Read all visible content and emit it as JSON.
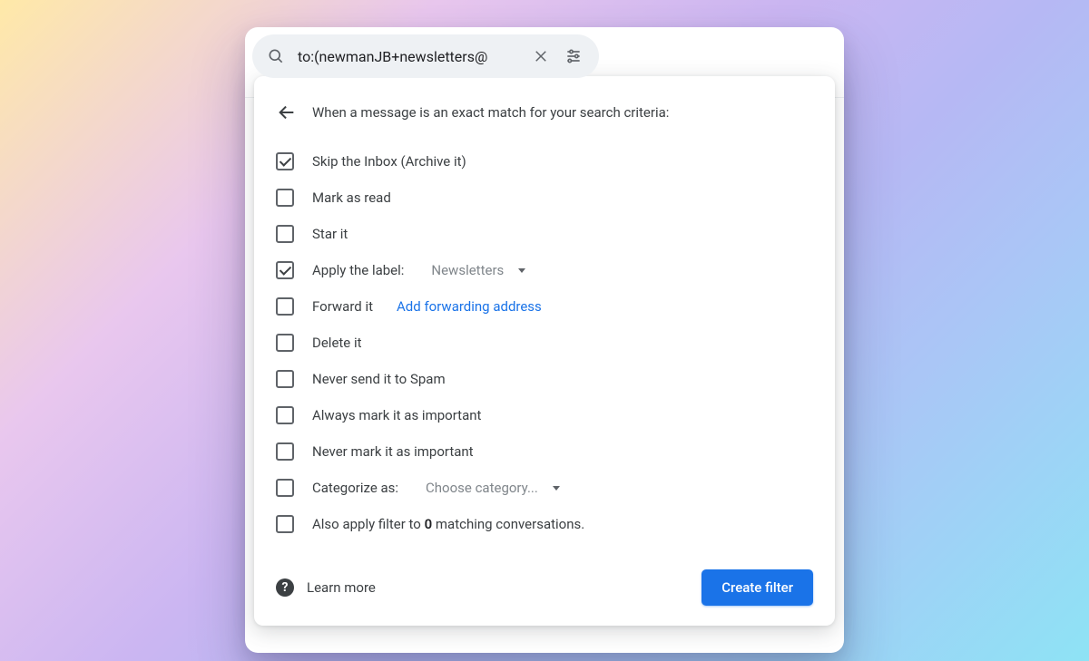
{
  "search": {
    "value": "to:(newmanJB+newsletters@"
  },
  "panel": {
    "heading": "When a message is an exact match for your search criteria:"
  },
  "options": {
    "skip_inbox": {
      "label": "Skip the Inbox (Archive it)",
      "checked": true
    },
    "mark_read": {
      "label": "Mark as read",
      "checked": false
    },
    "star": {
      "label": "Star it",
      "checked": false
    },
    "apply_label": {
      "label_prefix": "Apply the label:",
      "selected": "Newsletters",
      "checked": true
    },
    "forward": {
      "label": "Forward it",
      "link": "Add forwarding address",
      "checked": false
    },
    "delete": {
      "label": "Delete it",
      "checked": false
    },
    "never_spam": {
      "label": "Never send it to Spam",
      "checked": false
    },
    "always_important": {
      "label": "Always mark it as important",
      "checked": false
    },
    "never_important": {
      "label": "Never mark it as important",
      "checked": false
    },
    "categorize": {
      "label_prefix": "Categorize as:",
      "selected": "Choose category...",
      "checked": false
    },
    "also_apply": {
      "prefix": "Also apply filter to ",
      "count": "0",
      "suffix": " matching conversations.",
      "checked": false
    }
  },
  "footer": {
    "learn_more": "Learn more",
    "create": "Create filter"
  }
}
